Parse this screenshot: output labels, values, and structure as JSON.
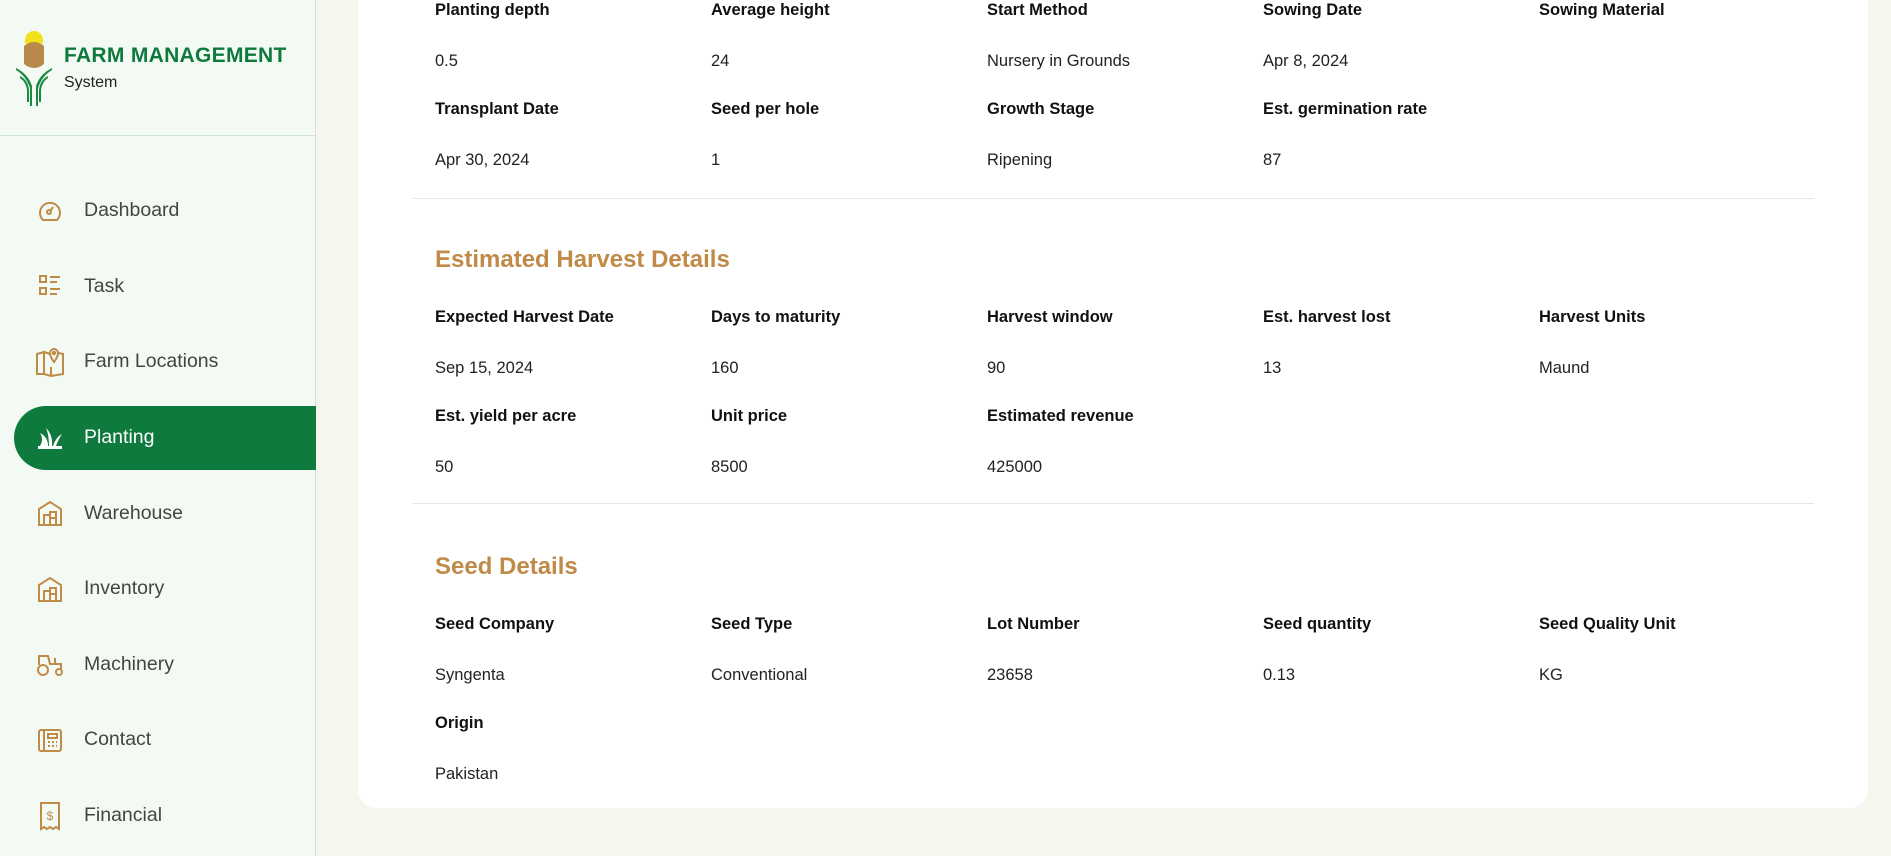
{
  "brand": {
    "title": "FARM MANAGEMENT",
    "subtitle": "System"
  },
  "nav": [
    {
      "label": "Dashboard",
      "icon": "gauge-icon"
    },
    {
      "label": "Task",
      "icon": "checklist-icon"
    },
    {
      "label": "Farm Locations",
      "icon": "map-pin-icon"
    },
    {
      "label": "Planting",
      "icon": "sprout-icon",
      "active": true
    },
    {
      "label": "Warehouse",
      "icon": "warehouse-icon"
    },
    {
      "label": "Inventory",
      "icon": "inventory-icon"
    },
    {
      "label": "Machinery",
      "icon": "tractor-icon"
    },
    {
      "label": "Contact",
      "icon": "contact-icon"
    },
    {
      "label": "Financial",
      "icon": "receipt-dollar-icon"
    }
  ],
  "planting": {
    "fields": [
      {
        "label": "Planting depth",
        "value": "0.5"
      },
      {
        "label": "Average height",
        "value": "24"
      },
      {
        "label": "Start Method",
        "value": "Nursery in Grounds"
      },
      {
        "label": "Sowing Date",
        "value": "Apr 8, 2024"
      },
      {
        "label": "Sowing Material",
        "value": ""
      },
      {
        "label": "Transplant Date",
        "value": "Apr 30, 2024"
      },
      {
        "label": "Seed per hole",
        "value": "1"
      },
      {
        "label": "Growth Stage",
        "value": "Ripening"
      },
      {
        "label": "Est. germination rate",
        "value": "87"
      }
    ]
  },
  "harvest": {
    "title": "Estimated Harvest Details",
    "fields": [
      {
        "label": "Expected Harvest Date",
        "value": "Sep 15, 2024"
      },
      {
        "label": "Days to maturity",
        "value": "160"
      },
      {
        "label": "Harvest window",
        "value": "90"
      },
      {
        "label": "Est. harvest lost",
        "value": "13"
      },
      {
        "label": "Harvest Units",
        "value": "Maund"
      },
      {
        "label": "Est. yield per acre",
        "value": "50"
      },
      {
        "label": "Unit price",
        "value": "8500"
      },
      {
        "label": "Estimated revenue",
        "value": "425000"
      }
    ]
  },
  "seed": {
    "title": "Seed Details",
    "fields": [
      {
        "label": "Seed Company",
        "value": "Syngenta"
      },
      {
        "label": "Seed Type",
        "value": "Conventional"
      },
      {
        "label": "Lot Number",
        "value": "23658"
      },
      {
        "label": "Seed quantity",
        "value": "0.13"
      },
      {
        "label": "Seed Quality Unit",
        "value": "KG"
      },
      {
        "label": "Origin",
        "value": "Pakistan"
      }
    ]
  },
  "colors": {
    "primary": "#0F7A3D",
    "accent": "#C08A48"
  }
}
